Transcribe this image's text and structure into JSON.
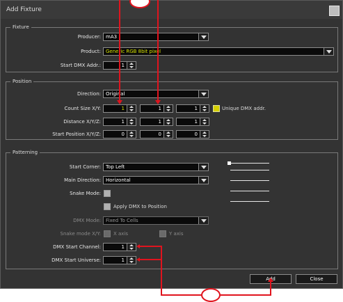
{
  "window": {
    "title": "Add Fixture"
  },
  "fixture_group": {
    "label": "Fixture",
    "producer_label": "Producer:",
    "producer_value": "mA3",
    "product_label": "Product:",
    "product_value": "Generic RGB 8bit pixel",
    "start_dmx_label": "Start DMX Addr.:",
    "start_dmx_value": "1"
  },
  "position_group": {
    "label": "Position",
    "direction_label": "Direction:",
    "direction_value": "Original",
    "count_label": "Count Size X/Y:",
    "count_values": [
      "1",
      "1",
      "1"
    ],
    "unique_dmx_label": "Unique DMX addr.",
    "distance_label": "Distance X/Y/Z:",
    "distance_values": [
      "1",
      "1",
      "1"
    ],
    "start_position_label": "Start Position X/Y/Z:",
    "start_position_values": [
      "0",
      "0",
      "0"
    ]
  },
  "pattern_group": {
    "label": "Patterning",
    "start_corner_label": "Start Corner:",
    "start_corner_value": "Top Left",
    "main_direction_label": "Main Direction:",
    "main_direction_value": "Horizontal",
    "snake_mode_label": "Snake Mode:",
    "apply_dmx_label": "Apply DMX to Position",
    "dmx_mode_label": "DMX Mode:",
    "dmx_mode_value": "Fixed To Cells",
    "snake_mode_xy_label": "Snake mode X/Y:",
    "snake_x_label": "X axis",
    "snake_y_label": "Y axis",
    "dmx_start_channel_label": "DMX Start Channel:",
    "dmx_start_channel_value": "1",
    "dmx_start_universe_label": "DMX Start Universe:",
    "dmx_start_universe_value": "1"
  },
  "buttons": {
    "add": "Add",
    "close": "Close"
  },
  "colors": {
    "annotation": "#e0141e",
    "product_text": "#d4e000",
    "window_bg": "#333333"
  },
  "icons": {
    "close": "close-icon",
    "dropdown": "chevron-down-icon",
    "spinner": "spinner-arrows-icon"
  }
}
